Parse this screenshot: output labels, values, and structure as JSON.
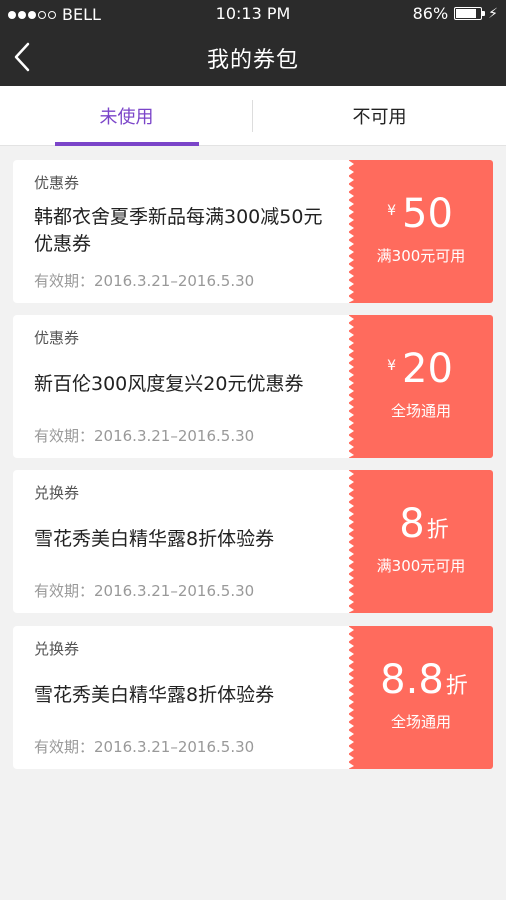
{
  "status_bar": {
    "carrier": "BELL",
    "time": "10:13 PM",
    "battery": "86%",
    "battery_level": 0.86
  },
  "navbar": {
    "title": "我的券包",
    "back_icon": "chevron-left-icon"
  },
  "tabs": [
    {
      "label": "未使用",
      "active": true
    },
    {
      "label": "不可用",
      "active": false
    }
  ],
  "coupons": [
    {
      "type": "优惠券",
      "title": "韩都衣舍夏季新品每满300减50元优惠券",
      "validity": "有效期：2016.3.21–2016.5.30",
      "currency": "¥",
      "amount": "50",
      "unit": "",
      "condition": "满300元可用"
    },
    {
      "type": "优惠券",
      "title": "新百伦300风度复兴20元优惠券",
      "validity": "有效期：2016.3.21–2016.5.30",
      "currency": "¥",
      "amount": "20",
      "unit": "",
      "condition": "全场通用"
    },
    {
      "type": "兑换券",
      "title": "雪花秀美白精华露8折体验券",
      "validity": "有效期：2016.3.21–2016.5.30",
      "currency": "",
      "amount": "8",
      "unit": "折",
      "condition": "满300元可用"
    },
    {
      "type": "兑换券",
      "title": "雪花秀美白精华露8折体验券",
      "validity": "有效期：2016.3.21–2016.5.30",
      "currency": "",
      "amount": "8.8",
      "unit": "折",
      "condition": "全场通用"
    }
  ],
  "colors": {
    "accent": "#7b45c9",
    "coupon_bg": "#ff6b5d",
    "navbar_bg": "#2b2b2b"
  }
}
